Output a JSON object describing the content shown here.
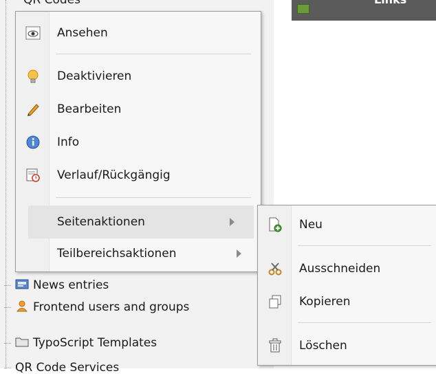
{
  "tree": {
    "top_clipped_label": "QR Codes",
    "items": [
      {
        "label": "News entries",
        "icon": "news-icon"
      },
      {
        "label": "Frontend users and groups",
        "icon": "users-icon"
      },
      {
        "label": "TypoScript Templates",
        "icon": "folder-icon"
      },
      {
        "label": "QR Code Services",
        "icon": "page-icon"
      }
    ]
  },
  "header": {
    "label": "Links"
  },
  "context_menu": {
    "items": [
      {
        "label": "Ansehen",
        "icon": "view-icon"
      },
      {
        "label": "Deaktivieren",
        "icon": "lightbulb-icon"
      },
      {
        "label": "Bearbeiten",
        "icon": "pencil-icon"
      },
      {
        "label": "Info",
        "icon": "info-icon"
      },
      {
        "label": "Verlauf/Rückgängig",
        "icon": "history-icon"
      },
      {
        "label": "Seitenaktionen",
        "submenu": true
      },
      {
        "label": "Teilbereichsaktionen",
        "submenu": true
      }
    ]
  },
  "submenu": {
    "items": [
      {
        "label": "Neu",
        "icon": "new-page-icon"
      },
      {
        "label": "Ausschneiden",
        "icon": "scissors-icon"
      },
      {
        "label": "Kopieren",
        "icon": "copy-icon"
      },
      {
        "label": "Löschen",
        "icon": "trash-icon"
      }
    ]
  },
  "colors": {
    "menu_bg": "#f7f7f7",
    "highlight": "#e4e4e4",
    "tree_bg": "#f2f2f2",
    "header_dark": "#5a5a5a"
  }
}
